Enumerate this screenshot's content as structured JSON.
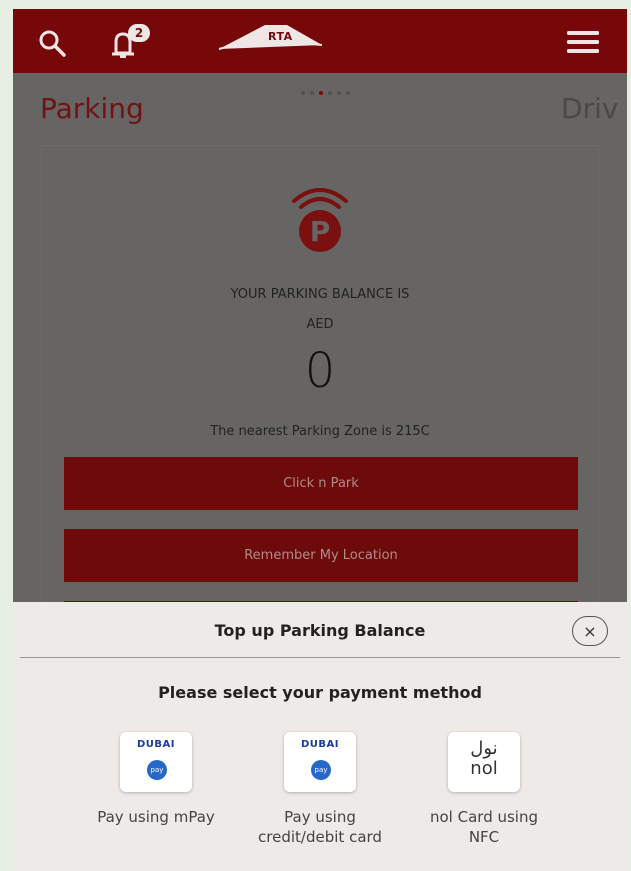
{
  "app": {
    "logo_text": "RTA",
    "notification_count": "2"
  },
  "carousel": {
    "current_title": "Parking",
    "next_title": "Driv",
    "page_count": 6,
    "active_index": 2
  },
  "parking": {
    "balance_label": "YOUR PARKING BALANCE IS",
    "currency": "AED",
    "balance_value": "0",
    "nearest_zone": "The nearest Parking Zone is 215C",
    "click_n_park_label": "Click n Park",
    "remember_location_label": "Remember My Location"
  },
  "topup_sheet": {
    "title": "Top up Parking Balance",
    "close_symbol": "×",
    "subtitle": "Please select your payment method",
    "options": [
      {
        "icon_text": "DUBAI",
        "icon_sub": "pay",
        "label": "Pay using mPay",
        "icon": "dubai-pay-icon"
      },
      {
        "icon_text": "DUBAI",
        "icon_sub": "pay",
        "label": "Pay using credit/debit card",
        "icon": "dubai-pay-icon"
      },
      {
        "icon_text_ar": "نول",
        "icon_text": "nol",
        "label": "nol Card using NFC",
        "icon": "nol-card-icon"
      }
    ]
  },
  "colors": {
    "brand_red": "#760809",
    "button_red_dimmed": "#6d0a0a",
    "overlay_gray": "#676563",
    "sheet_bg": "#edeae7",
    "outer_bg": "#e6efe1"
  },
  "icons": [
    "search-icon",
    "bell-icon",
    "rta-logo",
    "menu-icon",
    "parking-icon",
    "close-icon",
    "dubai-pay-icon",
    "nol-card-icon"
  ]
}
